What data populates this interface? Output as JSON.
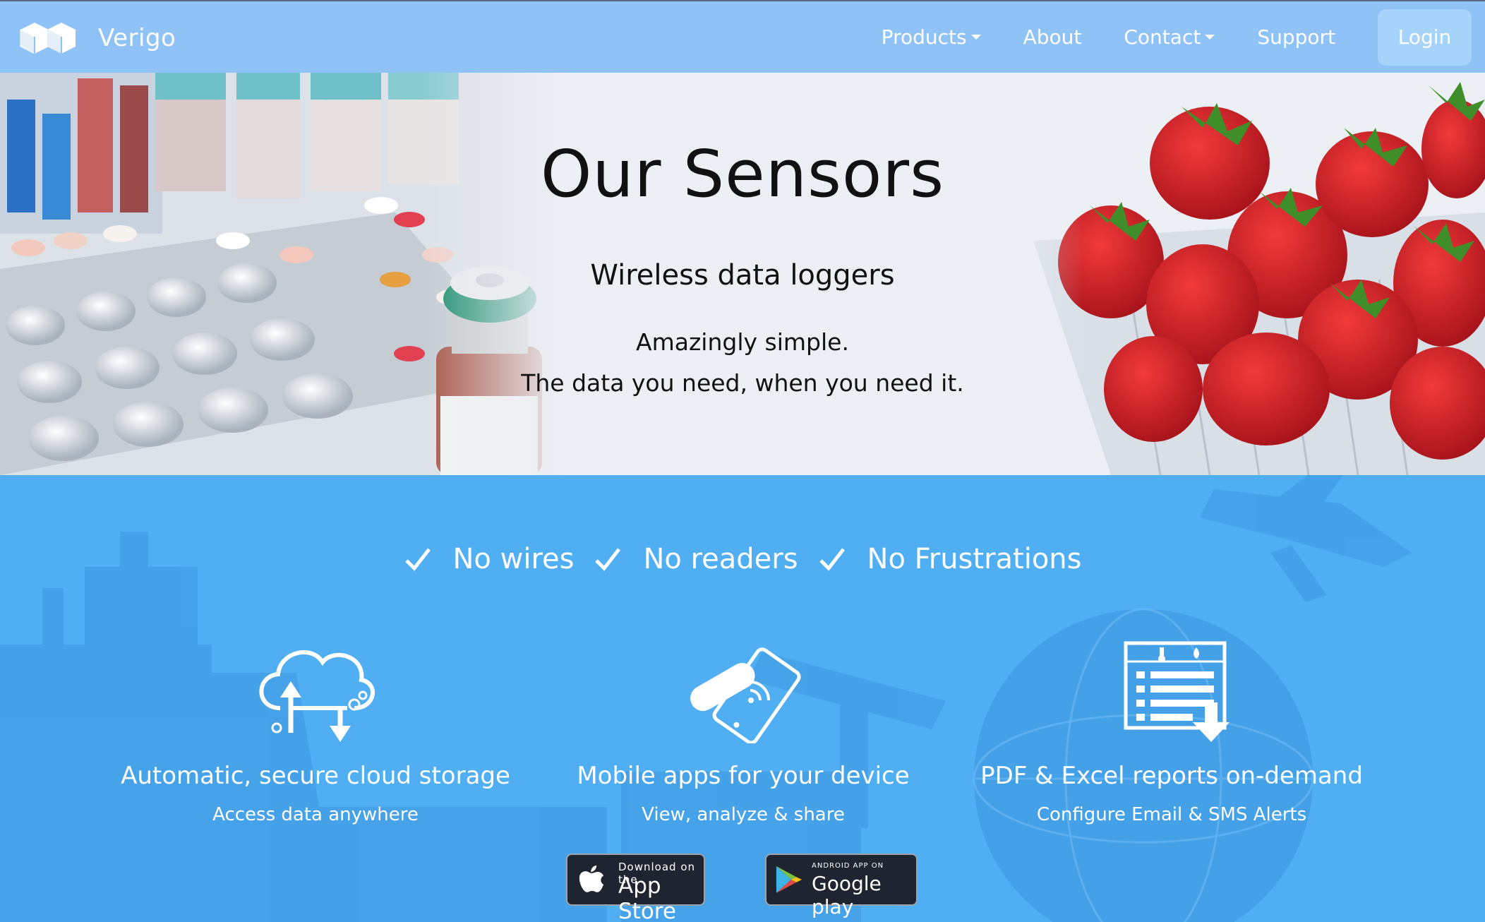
{
  "nav": {
    "brand": "Verigo",
    "links": [
      {
        "label": "Products",
        "dropdown": true
      },
      {
        "label": "About",
        "dropdown": false
      },
      {
        "label": "Contact",
        "dropdown": true
      },
      {
        "label": "Support",
        "dropdown": false
      }
    ],
    "login": "Login"
  },
  "hero": {
    "title": "Our Sensors",
    "subtitle": "Wireless data loggers",
    "line1": "Amazingly simple.",
    "line2": "The data you need, when you need it."
  },
  "checks": [
    "No wires",
    "No readers",
    "No Frustrations"
  ],
  "features": [
    {
      "icon": "cloud-storage-icon",
      "title": "Automatic, secure cloud storage",
      "subtitle": "Access data anywhere"
    },
    {
      "icon": "mobile-sensor-icon",
      "title": "Mobile apps for your device",
      "subtitle": "View, analyze & share"
    },
    {
      "icon": "report-download-icon",
      "title": "PDF & Excel reports on-demand",
      "subtitle": "Configure Email & SMS Alerts"
    }
  ],
  "stores": {
    "appstore_small": "Download on the",
    "appstore_big": "App Store",
    "gplay_small": "ANDROID APP ON",
    "gplay_big": "Google play"
  },
  "colors": {
    "nav_bg": "#8fc2f6",
    "features_bg": "#50aef3",
    "hero_bg": "#eceff3"
  }
}
